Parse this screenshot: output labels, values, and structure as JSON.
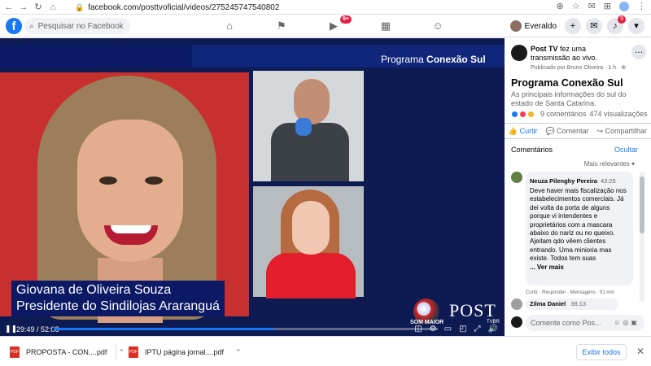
{
  "browser": {
    "url": "facebook.com/posttvoficial/videos/275245747540802",
    "back": "←",
    "forward": "→",
    "reload": "↻",
    "home": "⌂"
  },
  "fbnav": {
    "logo": "f",
    "search_placeholder": "Pesquisar no Facebook",
    "watch_badge": "9+",
    "user_name": "Everaldo",
    "notif_badge": "9"
  },
  "video": {
    "program_prefix": "Programa ",
    "program_name": "Conexão Sul",
    "lower_line1": "Giovana de Oliveira Souza",
    "lower_line2": "Presidente do Sindilojas Araranguá",
    "logo_text": "SOM MAIOR",
    "post_logo": "POST",
    "post_tv": "TVBR",
    "current_time": "29:49",
    "duration": "52:08",
    "progress": 0.572
  },
  "side": {
    "page_name": "Post TV",
    "action_text": " fez uma transmissão ao vivo.",
    "published_by": "Publicado por Bruno Oliveira",
    "time_ago": "1 h",
    "title": "Programa Conexão Sul",
    "description": "As principais informações do sul do estado de Santa Catarina.",
    "comments_count": "9 comentários",
    "views": "474 visualizações",
    "like_label": "Curtir",
    "comment_label": "Comentar",
    "share_label": "Compartilhar",
    "comments_title": "Comentários",
    "hide_label": "Ocultar",
    "sort_label": "Mais relevantes",
    "comments": [
      {
        "author": "Neuza Pilenghy Pereira",
        "time": "43:25",
        "text": "Deve haver mais fiscalização nos estabelecimentos comerciais. Já dei volta da porta de alguns porque vi intendentes e proprietários com a mascara abaixo do nariz ou no queixo. Ajeitam qdo vêem clientes entrando. Uma minioria mas existe. Todos tem suas",
        "more": "... Ver mais",
        "links": "Curtir · Responder · Mensagens · 51 min"
      },
      {
        "author": "Zilma Daniel",
        "time": "38:13"
      }
    ],
    "compose_placeholder": "Comente como Pos..."
  },
  "downloads": {
    "items": [
      {
        "name": "PROPOSTA - CON....pdf"
      },
      {
        "name": "IPTU página jornal....pdf"
      }
    ],
    "show_all": "Exibir todos"
  }
}
